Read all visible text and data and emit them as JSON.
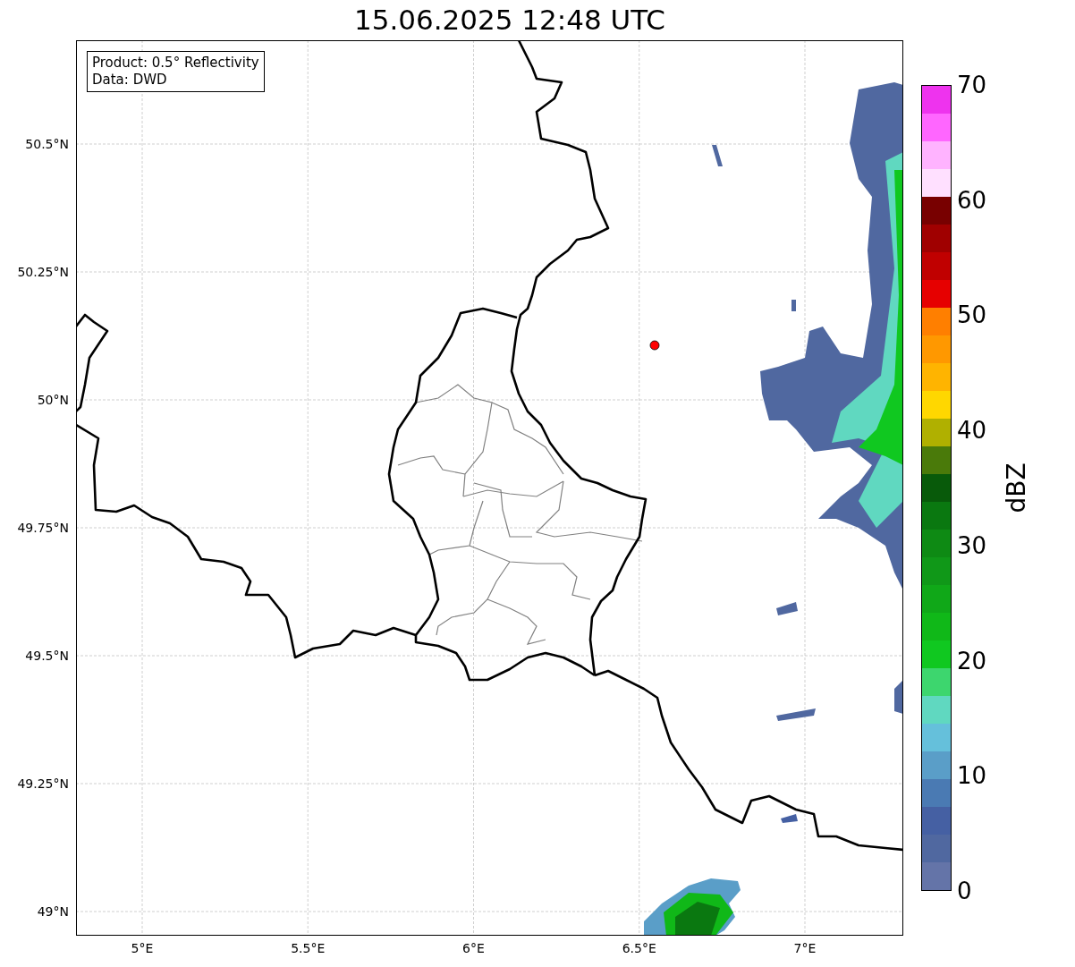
{
  "title": "15.06.2025 12:48 UTC",
  "map": {
    "info": [
      "Product: 0.5° Reflectivity",
      "Data: DWD"
    ],
    "xticks": [
      "5°E",
      "5.5°E",
      "6°E",
      "6.5°E",
      "7°E"
    ],
    "yticks": [
      "50.5°N",
      "50.25°N",
      "50°N",
      "49.75°N",
      "49.5°N",
      "49.25°N",
      "49°N"
    ]
  },
  "colorbar": {
    "ticks": [
      "70",
      "60",
      "50",
      "40",
      "30",
      "20",
      "10",
      "0"
    ],
    "label": "dBZ",
    "bins": [
      {
        "color": "#ee33ee"
      },
      {
        "color": "#ff66ff"
      },
      {
        "color": "#ffb3ff"
      },
      {
        "color": "#ffe0ff"
      },
      {
        "color": "#780000"
      },
      {
        "color": "#a00000"
      },
      {
        "color": "#c00000"
      },
      {
        "color": "#e60000"
      },
      {
        "color": "#ff7f00"
      },
      {
        "color": "#ff9800"
      },
      {
        "color": "#ffb400"
      },
      {
        "color": "#ffd700"
      },
      {
        "color": "#b0b000"
      },
      {
        "color": "#4a7a0a"
      },
      {
        "color": "#085a0a"
      },
      {
        "color": "#0a7810"
      },
      {
        "color": "#0e8a14"
      },
      {
        "color": "#109818"
      },
      {
        "color": "#10a818"
      },
      {
        "color": "#10b818"
      },
      {
        "color": "#10c820"
      },
      {
        "color": "#3dd66e"
      },
      {
        "color": "#60d8c0"
      },
      {
        "color": "#65c0db"
      },
      {
        "color": "#5a9ec8"
      },
      {
        "color": "#4a7ab3"
      },
      {
        "color": "#4560a3"
      },
      {
        "color": "#5068a0"
      },
      {
        "color": "#6474a8"
      }
    ]
  }
}
